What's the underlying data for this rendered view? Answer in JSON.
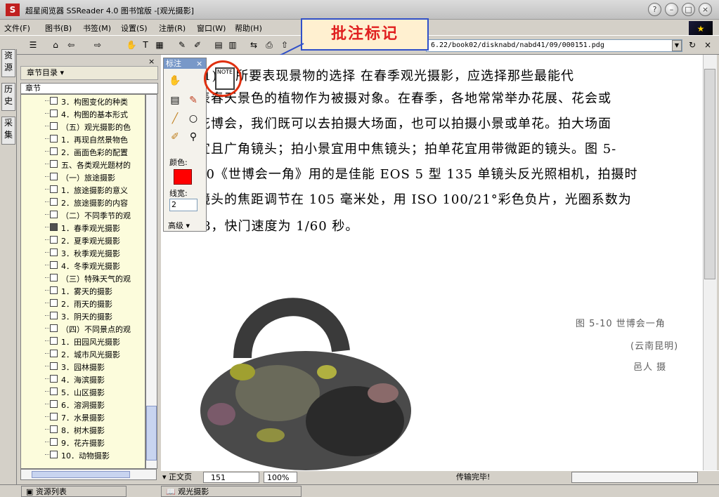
{
  "window": {
    "title": "超星阅览器 SSReader 4.0 图书馆版 -[观光摄影]",
    "app_icon": "app-logo-icon"
  },
  "menubar": {
    "items": [
      "文件(F)",
      "图书(B)",
      "书签(M)",
      "设置(S)",
      "注册(R)",
      "窗口(W)",
      "帮助(H)"
    ]
  },
  "toolbar": {
    "url": "6.22/book02/disknabd/nabd41/09/000151.pdg"
  },
  "callout": {
    "label": "批注标记"
  },
  "vtabs": [
    "资源",
    "历史",
    "采集"
  ],
  "sidebar": {
    "close": "×",
    "header": "章节目录 ▾",
    "subheader": "章节",
    "toc": [
      "3．构图变化的种类",
      "4．构图的基本形式",
      "（五）观光摄影的色",
      "1．再现自然景物色",
      "2．画面色彩的配置",
      "五、各类观光题材的",
      "（一）旅途摄影",
      "1．旅途摄影的意义",
      "2．旅途摄影的内容",
      "（二）不同季节的观",
      "1．春季观光摄影",
      "2．夏季观光摄影",
      "3．秋季观光摄影",
      "4．冬季观光摄影",
      "（三）特殊天气的观",
      "1．雾天的摄影",
      "2．雨天的摄影",
      "3．阴天的摄影",
      "（四）不同景点的观",
      "1．田园风光摄影",
      "2．城市风光摄影",
      "3．园林摄影",
      "4．海滨摄影",
      "5．山区摄影",
      "6．溶洞摄影",
      "7．水景摄影",
      "8．树木摄影",
      "9．花卉摄影",
      "10．动物摄影"
    ],
    "selected_index": 10
  },
  "annotation_panel": {
    "title": "标注",
    "close": "×",
    "color_label": "颜色:",
    "color": "#ff0000",
    "linewidth_label": "线宽:",
    "linewidth": "2",
    "advanced": "高级 ▾"
  },
  "page": {
    "lines": [
      "(1) 对所要表现景物的选择   在春季观光摄影，应选择那些最能代",
      "表春天景色的植物作为被摄对象。在春季，各地常常举办花展、花会或",
      "花博会，我们既可以去拍摄大场面，也可以拍摄小景或单花。拍大场面",
      "宜且广角镜头；拍小景宜用中焦镜头；拍单花宜用带微距的镜头。图 5-",
      "10《世博会一角》用的是佳能 EOS 5 型 135 单镜头反光照相机，拍摄时",
      "镜头的焦距调节在 105 毫米处，用 ISO 100/21°彩色负片，光圈系数为",
      "/8，快门速度为 1/60 秒。"
    ],
    "caption1": "图 5-10  世博会一角",
    "caption2": "(云南昆明)",
    "caption3": "邑人  摄"
  },
  "statusbar": {
    "mode": "▾ 正文页",
    "page": "151",
    "zoom": "100%",
    "status": "传输完毕!"
  },
  "taskbar": {
    "left": "资源列表",
    "right": "观光摄影"
  }
}
